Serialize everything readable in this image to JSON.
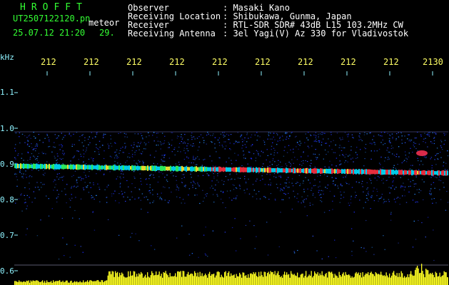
{
  "header": {
    "program": "HROFFT",
    "filename": "UT2507122120.pn",
    "datetime": "25.07.12 21:20",
    "mode": "meteor",
    "snr": "29."
  },
  "info": [
    {
      "label": "Observer",
      "value": ": Masaki Kano"
    },
    {
      "label": "Receiving Location",
      "value": ": Shibukawa, Gunma, Japan"
    },
    {
      "label": "Receiver",
      "value": ": RTL-SDR SDR# 43dB L15 103.2MHz CW"
    },
    {
      "label": "Receiving Antenna",
      "value": ": 3el Yagi(V) Az 330 for Vladivostok"
    }
  ],
  "axis": {
    "unit": "kHz",
    "x_ticks": [
      "212",
      "212",
      "212",
      "212",
      "212",
      "212",
      "212",
      "212",
      "212",
      "2130"
    ],
    "y_ticks": [
      "1.1",
      "1.0",
      "0.9",
      "0.8",
      "0.7",
      "0.6"
    ]
  },
  "colors": {
    "background": "#000000",
    "title_green": "#33ff33",
    "label_cyan": "#8ff3ff",
    "tick_yellow": "#ffff66",
    "signal_red": "#ff3344",
    "noise_blue": "#2a40ff"
  }
}
